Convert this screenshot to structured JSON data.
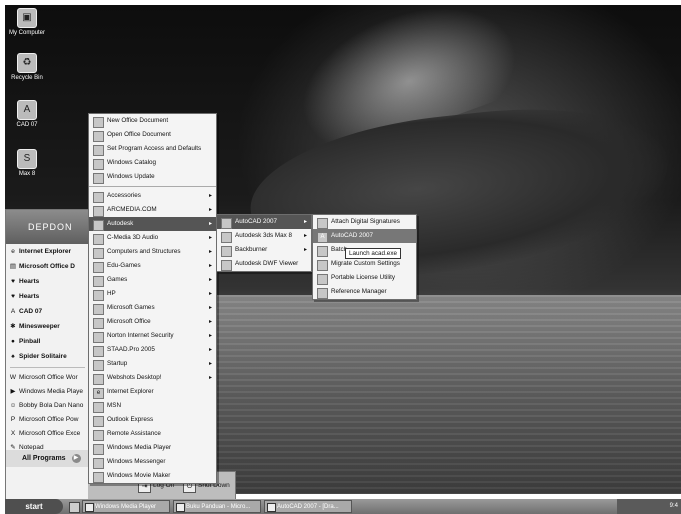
{
  "desktop": {
    "icons": [
      {
        "label": "My Computer",
        "icon": "computer-icon"
      },
      {
        "label": "Recycle Bin",
        "icon": "recycle-bin-icon"
      },
      {
        "label": "CAD 07",
        "icon": "cad-icon"
      },
      {
        "label": "Max 8",
        "icon": "max-icon"
      }
    ]
  },
  "start_panel": {
    "user_name": "DEPDON",
    "pinned": [
      "Internet Explorer",
      "Microsoft Office D",
      "Hearts",
      "Hearts",
      "CAD 07",
      "Minesweeper",
      "Pinball",
      "Spider Solitaire"
    ],
    "recent": [
      "Microsoft Office Wor",
      "Windows Media Playe",
      "Bobby Bola Dan Nano",
      "Microsoft Office Pow",
      "Microsoft Office Exce",
      "Notepad"
    ],
    "all_programs": "All Programs",
    "log_off": "Log Off",
    "shut_down": "Shut Down"
  },
  "programs_menu": {
    "top_items": [
      "New Office Document",
      "Open Office Document",
      "Set Program Access and Defaults",
      "Windows Catalog",
      "Windows Update"
    ],
    "items": [
      {
        "label": "Accessories",
        "sub": true
      },
      {
        "label": "ARCMEDIA.COM",
        "sub": true
      },
      {
        "label": "Autodesk",
        "sub": true
      },
      {
        "label": "C-Media 3D Audio",
        "sub": true
      },
      {
        "label": "Computers and Structures",
        "sub": true
      },
      {
        "label": "Edu-Games",
        "sub": true
      },
      {
        "label": "Games",
        "sub": true
      },
      {
        "label": "HP",
        "sub": true
      },
      {
        "label": "Microsoft Games",
        "sub": true
      },
      {
        "label": "Microsoft Office",
        "sub": true
      },
      {
        "label": "Norton Internet Security",
        "sub": true
      },
      {
        "label": "STAAD.Pro 2005",
        "sub": true
      },
      {
        "label": "Startup",
        "sub": true
      },
      {
        "label": "Webshots Desktop!",
        "sub": true
      },
      {
        "label": "Internet Explorer",
        "sub": false
      },
      {
        "label": "MSN",
        "sub": false
      },
      {
        "label": "Outlook Express",
        "sub": false
      },
      {
        "label": "Remote Assistance",
        "sub": false
      },
      {
        "label": "Windows Media Player",
        "sub": false
      },
      {
        "label": "Windows Messenger",
        "sub": false
      },
      {
        "label": "Windows Movie Maker",
        "sub": false
      }
    ]
  },
  "autodesk_menu": {
    "items": [
      {
        "label": "AutoCAD 2007",
        "sub": true
      },
      {
        "label": "Autodesk 3ds Max 8",
        "sub": true
      },
      {
        "label": "Backburner",
        "sub": true
      },
      {
        "label": "Autodesk DWF Viewer",
        "sub": false
      }
    ]
  },
  "autocad_menu": {
    "items": [
      "Attach Digital Signatures",
      "AutoCAD 2007",
      "Batch",
      "Migrate Custom Settings",
      "Portable License Utility",
      "Reference Manager"
    ]
  },
  "tooltip": "Launch acad.exe",
  "taskbar": {
    "start": "start",
    "tasks": [
      "Windows Media Player",
      "Buku Panduan - Micro...",
      "AutoCAD 2007 - [Dra..."
    ],
    "clock": "9:4"
  }
}
